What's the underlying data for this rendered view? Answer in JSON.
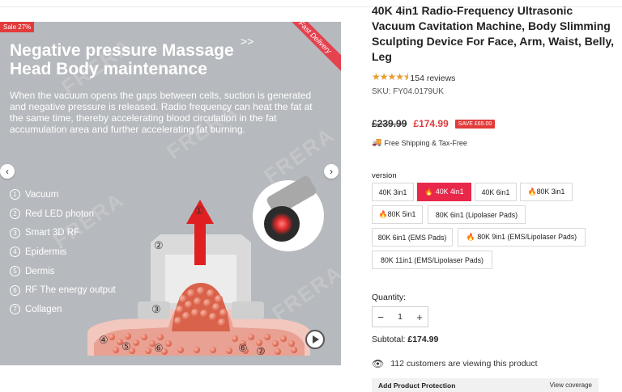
{
  "gallery": {
    "sale_badge": "Sale 27%",
    "ribbon": "Fast Delivery",
    "hero_title": "Negative  pressure Massage Head Body maintenance",
    "hero_arrows": ">>",
    "hero_desc": "When the vacuum opens the gaps between cells, suction is generated and negative pressure is released. Radio frequency can heat the fat at the same time, thereby accelerating blood circulation in the fat accumulation area and further accelerating fat burning.",
    "legend": [
      {
        "num": "1",
        "label": "Vacuum"
      },
      {
        "num": "2",
        "label": "Red LED photon"
      },
      {
        "num": "3",
        "label": "Smart 3D RF"
      },
      {
        "num": "4",
        "label": "Epidermis"
      },
      {
        "num": "5",
        "label": "Dermis"
      },
      {
        "num": "6",
        "label": "RF The energy output"
      },
      {
        "num": "7",
        "label": "Collagen"
      }
    ],
    "diagram_markers": [
      "①",
      "②",
      "③",
      "④",
      "⑤",
      "⑥",
      "⑥",
      "⑦"
    ],
    "prev_icon": "‹",
    "next_icon": "›",
    "watermark": "FRERA"
  },
  "product": {
    "title": "40K 4in1 Radio-Frequency Ultrasonic Vacuum Cavitation Machine, Body Slimming Sculpting Device For Face, Arm, Waist, Belly, Leg",
    "stars": "★★★★⯨",
    "reviews": "154 reviews",
    "sku": "SKU:  FY04.0179UK",
    "price_old": "£239.99",
    "price_new": "£174.99",
    "save_badge": "SAVE £65.00",
    "shipping": "Free Shipping & Tax-Free",
    "version_label": "version",
    "variants": [
      {
        "label": "40K 3in1",
        "selected": false
      },
      {
        "label": "🔥 40K 4in1",
        "selected": true
      },
      {
        "label": "40K 6in1",
        "selected": false
      },
      {
        "label": "🔥80K 3in1",
        "selected": false
      },
      {
        "label": "🔥80K 5in1",
        "selected": false
      },
      {
        "label": "80K 6in1 (Lipolaser Pads)",
        "selected": false
      },
      {
        "label": "80K 6in1 (EMS Pads)",
        "selected": false
      },
      {
        "label": "🔥 80K 9in1 (EMS/Lipolaser Pads)",
        "selected": false
      },
      {
        "label": "80K 11in1 (EMS/Lipolaser Pads)",
        "selected": false
      }
    ],
    "quantity_label": "Quantity:",
    "quantity_value": "1",
    "qty_minus": "−",
    "qty_plus": "+",
    "subtotal_label": "Subtotal:",
    "subtotal_value": "£174.99",
    "viewers": "112 customers are viewing this product",
    "protection_title": "Add Product Protection",
    "protection_link": "View coverage"
  },
  "colors": {
    "accent": "#e8274a",
    "sale_red": "#e23b3b",
    "star": "#e89b2f"
  }
}
